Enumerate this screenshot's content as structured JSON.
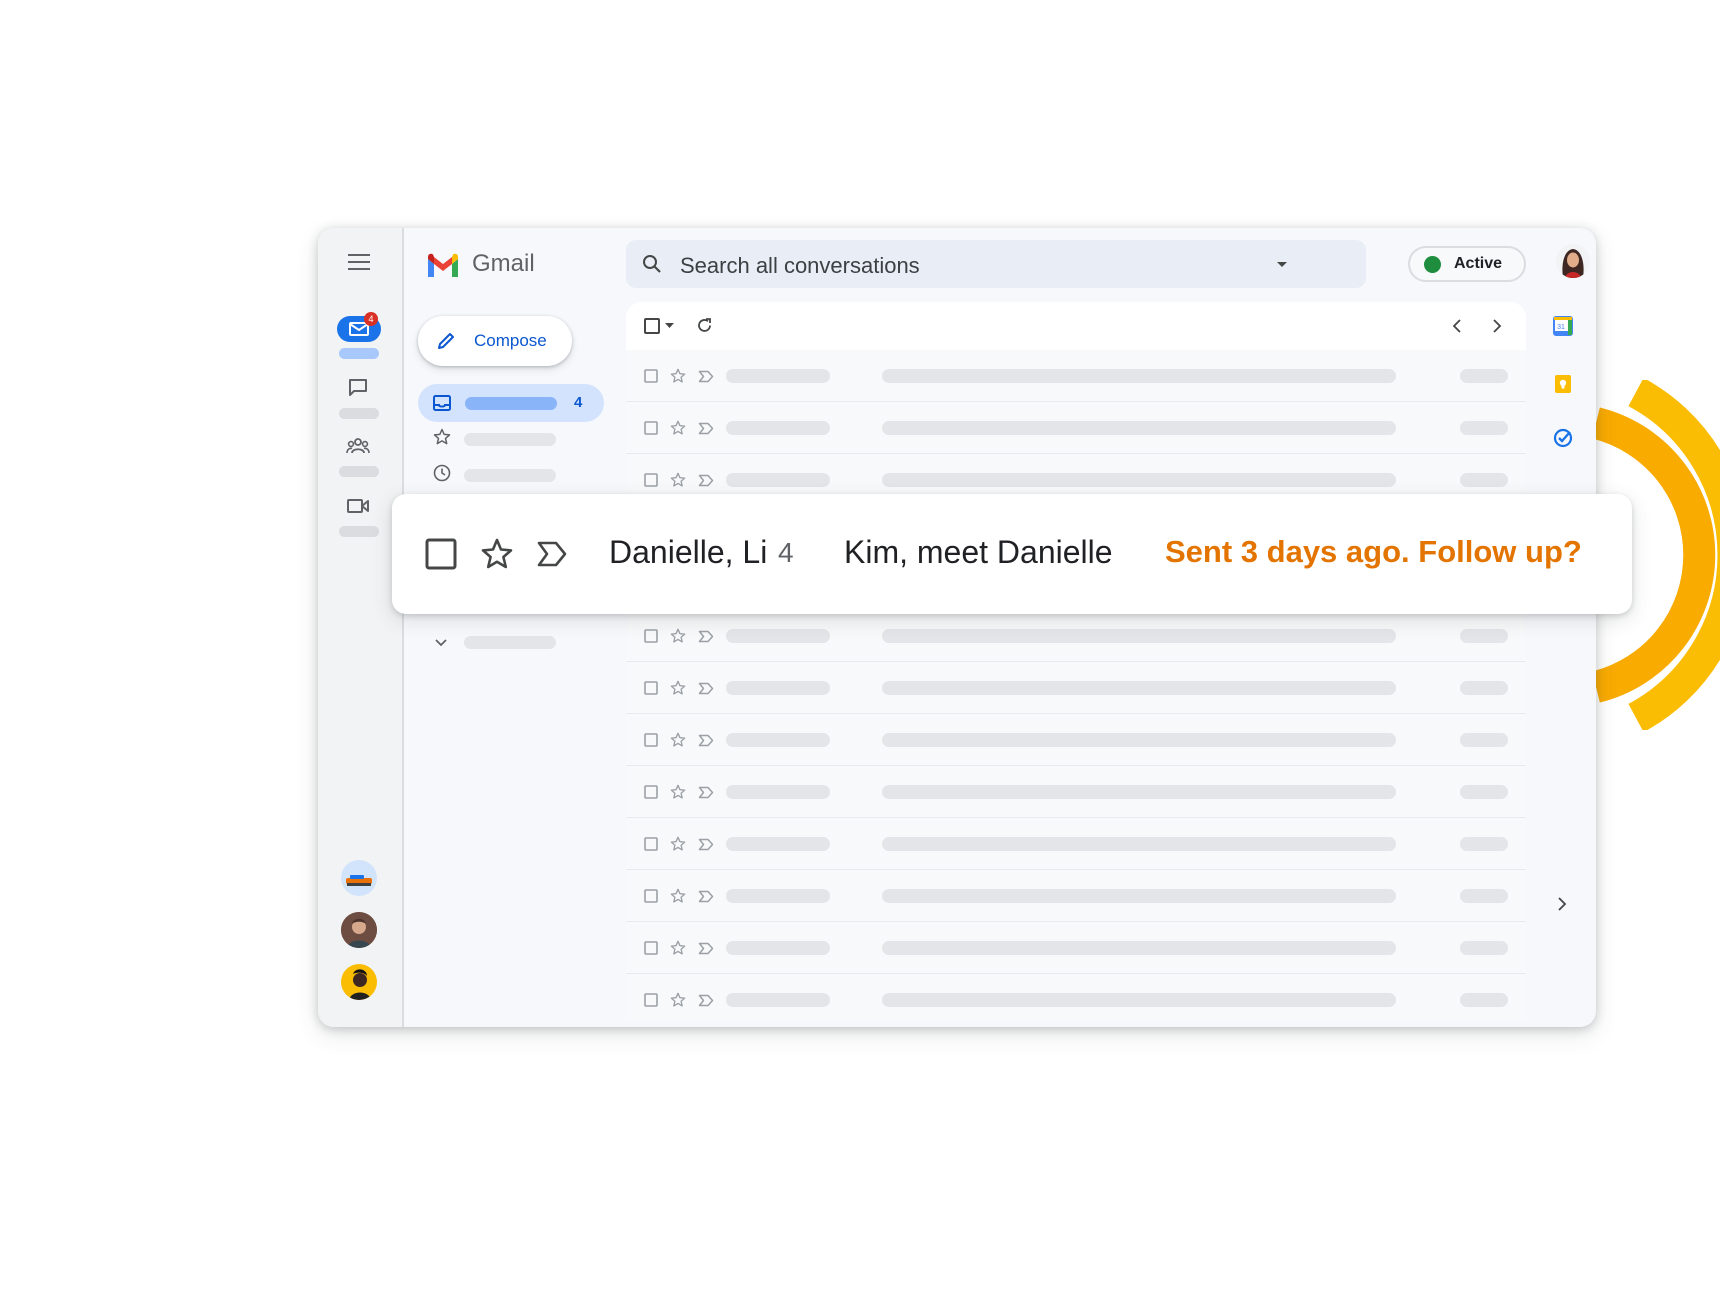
{
  "app": {
    "name": "Gmail"
  },
  "search": {
    "placeholder": "Search all conversations"
  },
  "status": {
    "label": "Active",
    "color": "#1e8e3e"
  },
  "compose": {
    "label": "Compose"
  },
  "rail": {
    "mail_badge": "4"
  },
  "sidebar": {
    "inbox_count": "4"
  },
  "highlight": {
    "senders": "Danielle, Li",
    "count": "4",
    "subject": "Kim, meet Danielle",
    "nudge": "Sent 3 days ago. Follow up?",
    "nudge_color": "#e37400"
  },
  "colors": {
    "accent_blue": "#0b57d0",
    "wave_yellow": "#fbbc04",
    "wave_orange": "#f9ab00"
  },
  "icons": [
    "menu-icon",
    "mail-icon",
    "chat-icon",
    "spaces-icon",
    "meet-icon",
    "search-icon",
    "pencil-icon",
    "inbox-icon",
    "star-icon",
    "clock-icon",
    "chevron-down-icon",
    "checkbox-icon",
    "refresh-icon",
    "chevron-left-icon",
    "chevron-right-icon",
    "label-icon",
    "calendar-icon",
    "keep-icon",
    "tasks-icon"
  ]
}
